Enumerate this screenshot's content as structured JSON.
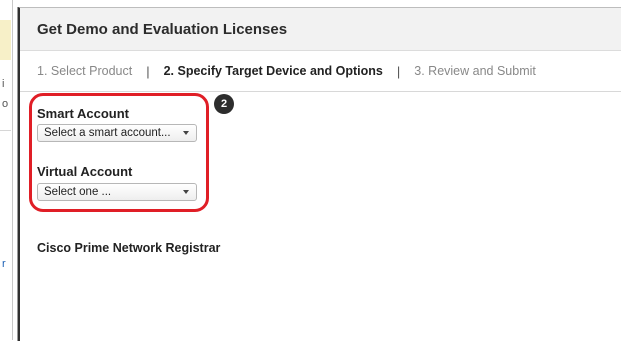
{
  "panel": {
    "title": "Get Demo and Evaluation Licenses"
  },
  "steps": [
    {
      "label": "1. Select Product",
      "state": "done"
    },
    {
      "label": "2. Specify Target Device and Options",
      "state": "active"
    },
    {
      "label": "3. Review and Submit",
      "state": "pending"
    }
  ],
  "separator": "|",
  "callout": {
    "number": "2",
    "color": "#e01e26"
  },
  "smart_account": {
    "label": "Smart Account",
    "selected": "Select a smart account..."
  },
  "virtual_account": {
    "label": "Virtual Account",
    "selected": "Select one ..."
  },
  "product": {
    "name": "Cisco Prime Network Registrar"
  },
  "left_fragments": [
    "i",
    "o",
    "r"
  ]
}
